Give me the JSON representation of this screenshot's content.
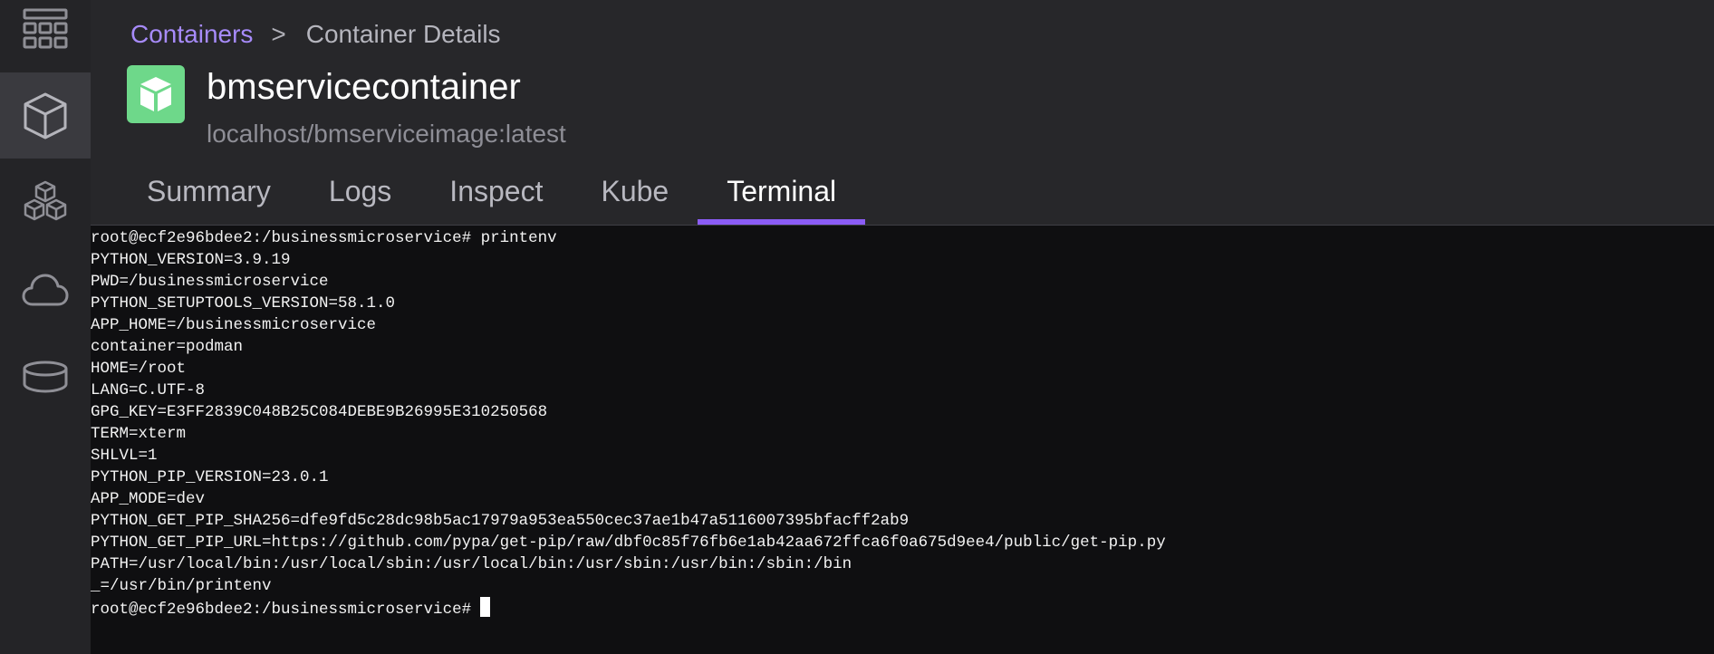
{
  "sidebar": {
    "items": [
      {
        "icon": "dashboard-icon"
      },
      {
        "icon": "container-cube-icon",
        "active": true
      },
      {
        "icon": "pods-icon"
      },
      {
        "icon": "cloud-icon"
      },
      {
        "icon": "volume-icon"
      }
    ]
  },
  "breadcrumb": {
    "link": "Containers",
    "separator": ">",
    "current": "Container Details"
  },
  "container": {
    "name": "bmservicecontainer",
    "image": "localhost/bmserviceimage:latest",
    "icon_color": "#6ed88a"
  },
  "tabs": [
    {
      "label": "Summary"
    },
    {
      "label": "Logs"
    },
    {
      "label": "Inspect"
    },
    {
      "label": "Kube"
    },
    {
      "label": "Terminal",
      "active": true
    }
  ],
  "accent_color": "#8b5cf6",
  "terminal": {
    "lines": [
      "root@ecf2e96bdee2:/businessmicroservice# printenv",
      "PYTHON_VERSION=3.9.19",
      "PWD=/businessmicroservice",
      "PYTHON_SETUPTOOLS_VERSION=58.1.0",
      "APP_HOME=/businessmicroservice",
      "container=podman",
      "HOME=/root",
      "LANG=C.UTF-8",
      "GPG_KEY=E3FF2839C048B25C084DEBE9B26995E310250568",
      "TERM=xterm",
      "SHLVL=1",
      "PYTHON_PIP_VERSION=23.0.1",
      "APP_MODE=dev",
      "PYTHON_GET_PIP_SHA256=dfe9fd5c28dc98b5ac17979a953ea550cec37ae1b47a5116007395bfacff2ab9",
      "PYTHON_GET_PIP_URL=https://github.com/pypa/get-pip/raw/dbf0c85f76fb6e1ab42aa672ffca6f0a675d9ee4/public/get-pip.py",
      "PATH=/usr/local/bin:/usr/local/sbin:/usr/local/bin:/usr/sbin:/usr/bin:/sbin:/bin",
      "_=/usr/bin/printenv"
    ],
    "prompt": "root@ecf2e96bdee2:/businessmicroservice#"
  }
}
